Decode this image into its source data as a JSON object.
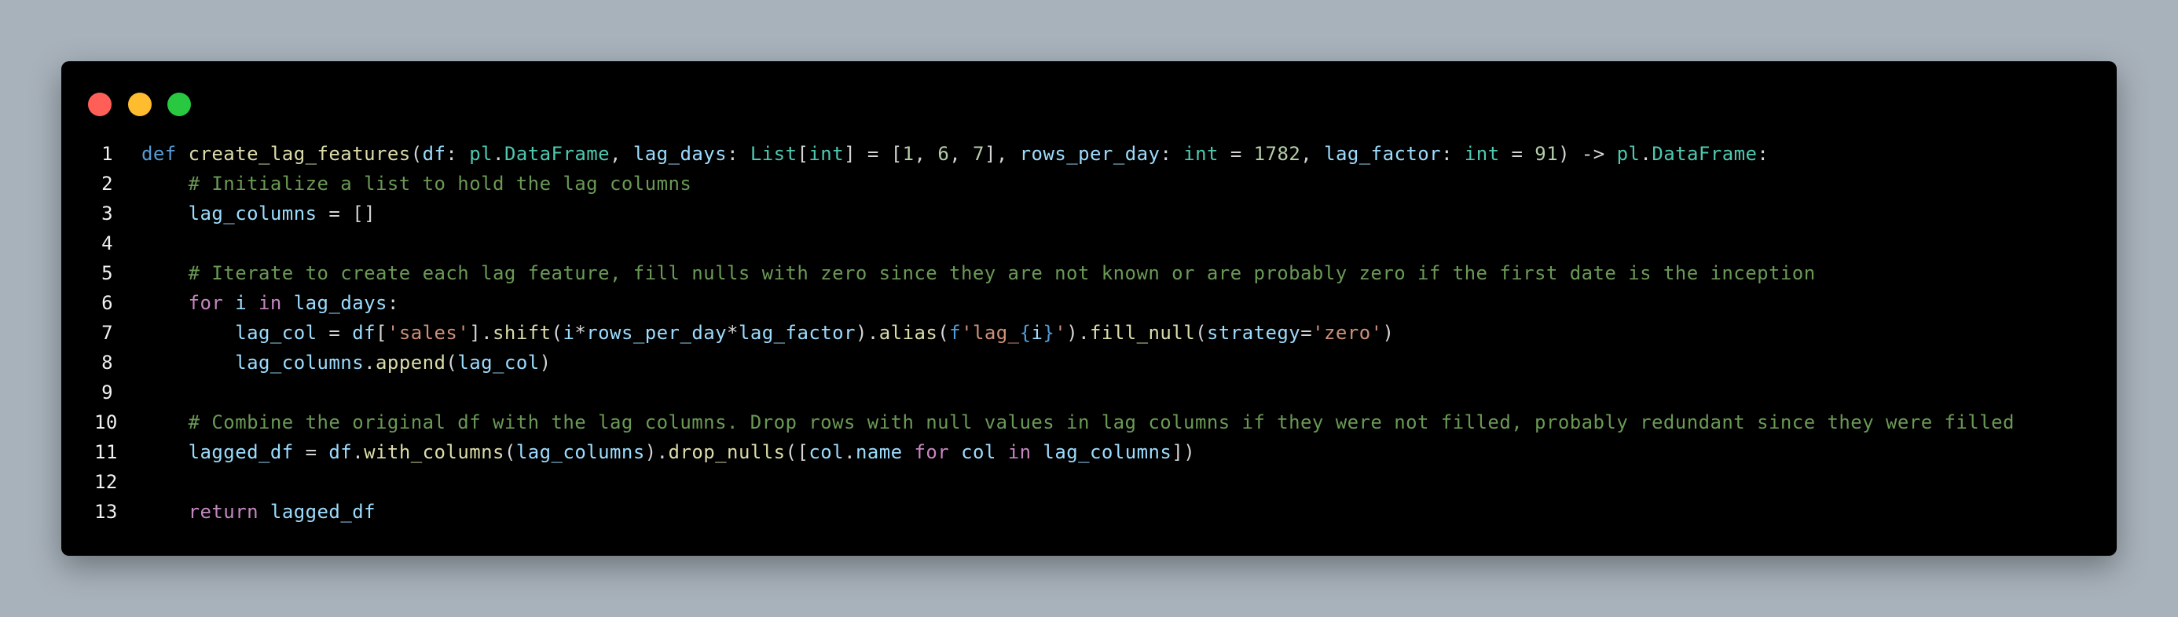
{
  "window": {
    "buttons": {
      "close_color": "#ff5f57",
      "minimize_color": "#febc2e",
      "maximize_color": "#28c840"
    }
  },
  "code": {
    "language": "python",
    "lines": [
      {
        "n": "1",
        "tokens": [
          [
            "kw",
            "def"
          ],
          [
            "punc",
            " "
          ],
          [
            "fn",
            "create_lag_features"
          ],
          [
            "punc",
            "("
          ],
          [
            "var",
            "df"
          ],
          [
            "punc",
            ": "
          ],
          [
            "ty",
            "pl"
          ],
          [
            "punc",
            "."
          ],
          [
            "ty",
            "DataFrame"
          ],
          [
            "punc",
            ", "
          ],
          [
            "var",
            "lag_days"
          ],
          [
            "punc",
            ": "
          ],
          [
            "ty",
            "List"
          ],
          [
            "punc",
            "["
          ],
          [
            "ty",
            "int"
          ],
          [
            "punc",
            "] = ["
          ],
          [
            "num",
            "1"
          ],
          [
            "punc",
            ", "
          ],
          [
            "num",
            "6"
          ],
          [
            "punc",
            ", "
          ],
          [
            "num",
            "7"
          ],
          [
            "punc",
            "], "
          ],
          [
            "var",
            "rows_per_day"
          ],
          [
            "punc",
            ": "
          ],
          [
            "ty",
            "int"
          ],
          [
            "punc",
            " = "
          ],
          [
            "num",
            "1782"
          ],
          [
            "punc",
            ", "
          ],
          [
            "var",
            "lag_factor"
          ],
          [
            "punc",
            ": "
          ],
          [
            "ty",
            "int"
          ],
          [
            "punc",
            " = "
          ],
          [
            "num",
            "91"
          ],
          [
            "punc",
            ") -> "
          ],
          [
            "ty",
            "pl"
          ],
          [
            "punc",
            "."
          ],
          [
            "ty",
            "DataFrame"
          ],
          [
            "punc",
            ":"
          ]
        ]
      },
      {
        "n": "2",
        "tokens": [
          [
            "punc",
            "    "
          ],
          [
            "cmt",
            "# Initialize a list to hold the lag columns"
          ]
        ]
      },
      {
        "n": "3",
        "tokens": [
          [
            "punc",
            "    "
          ],
          [
            "var",
            "lag_columns"
          ],
          [
            "punc",
            " = []"
          ]
        ]
      },
      {
        "n": "4",
        "tokens": []
      },
      {
        "n": "5",
        "tokens": [
          [
            "punc",
            "    "
          ],
          [
            "cmt",
            "# Iterate to create each lag feature, fill nulls with zero since they are not known or are probably zero if the first date is the inception"
          ]
        ]
      },
      {
        "n": "6",
        "tokens": [
          [
            "punc",
            "    "
          ],
          [
            "ctrl",
            "for"
          ],
          [
            "punc",
            " "
          ],
          [
            "var",
            "i"
          ],
          [
            "punc",
            " "
          ],
          [
            "ctrl",
            "in"
          ],
          [
            "punc",
            " "
          ],
          [
            "var",
            "lag_days"
          ],
          [
            "punc",
            ":"
          ]
        ]
      },
      {
        "n": "7",
        "tokens": [
          [
            "punc",
            "        "
          ],
          [
            "var",
            "lag_col"
          ],
          [
            "punc",
            " = "
          ],
          [
            "var",
            "df"
          ],
          [
            "punc",
            "["
          ],
          [
            "str",
            "'sales'"
          ],
          [
            "punc",
            "]."
          ],
          [
            "fn",
            "shift"
          ],
          [
            "punc",
            "("
          ],
          [
            "var",
            "i"
          ],
          [
            "punc",
            "*"
          ],
          [
            "var",
            "rows_per_day"
          ],
          [
            "punc",
            "*"
          ],
          [
            "var",
            "lag_factor"
          ],
          [
            "punc",
            ")."
          ],
          [
            "fn",
            "alias"
          ],
          [
            "punc",
            "("
          ],
          [
            "kw",
            "f"
          ],
          [
            "str",
            "'lag_"
          ],
          [
            "kw",
            "{"
          ],
          [
            "var",
            "i"
          ],
          [
            "kw",
            "}"
          ],
          [
            "str",
            "'"
          ],
          [
            "punc",
            ")."
          ],
          [
            "fn",
            "fill_null"
          ],
          [
            "punc",
            "("
          ],
          [
            "var",
            "strategy"
          ],
          [
            "punc",
            "="
          ],
          [
            "str",
            "'zero'"
          ],
          [
            "punc",
            ")"
          ]
        ]
      },
      {
        "n": "8",
        "tokens": [
          [
            "punc",
            "        "
          ],
          [
            "var",
            "lag_columns"
          ],
          [
            "punc",
            "."
          ],
          [
            "fn",
            "append"
          ],
          [
            "punc",
            "("
          ],
          [
            "var",
            "lag_col"
          ],
          [
            "punc",
            ")"
          ]
        ]
      },
      {
        "n": "9",
        "tokens": []
      },
      {
        "n": "10",
        "tokens": [
          [
            "punc",
            "    "
          ],
          [
            "cmt",
            "# Combine the original df with the lag columns. Drop rows with null values in lag columns if they were not filled, probably redundant since they were filled"
          ]
        ]
      },
      {
        "n": "11",
        "tokens": [
          [
            "punc",
            "    "
          ],
          [
            "var",
            "lagged_df"
          ],
          [
            "punc",
            " = "
          ],
          [
            "var",
            "df"
          ],
          [
            "punc",
            "."
          ],
          [
            "fn",
            "with_columns"
          ],
          [
            "punc",
            "("
          ],
          [
            "var",
            "lag_columns"
          ],
          [
            "punc",
            ")."
          ],
          [
            "fn",
            "drop_nulls"
          ],
          [
            "punc",
            "(["
          ],
          [
            "var",
            "col"
          ],
          [
            "punc",
            "."
          ],
          [
            "var",
            "name"
          ],
          [
            "punc",
            " "
          ],
          [
            "ctrl",
            "for"
          ],
          [
            "punc",
            " "
          ],
          [
            "var",
            "col"
          ],
          [
            "punc",
            " "
          ],
          [
            "ctrl",
            "in"
          ],
          [
            "punc",
            " "
          ],
          [
            "var",
            "lag_columns"
          ],
          [
            "punc",
            "])"
          ]
        ]
      },
      {
        "n": "12",
        "tokens": []
      },
      {
        "n": "13",
        "tokens": [
          [
            "punc",
            "    "
          ],
          [
            "ctrl",
            "return"
          ],
          [
            "punc",
            " "
          ],
          [
            "var",
            "lagged_df"
          ]
        ]
      }
    ]
  }
}
